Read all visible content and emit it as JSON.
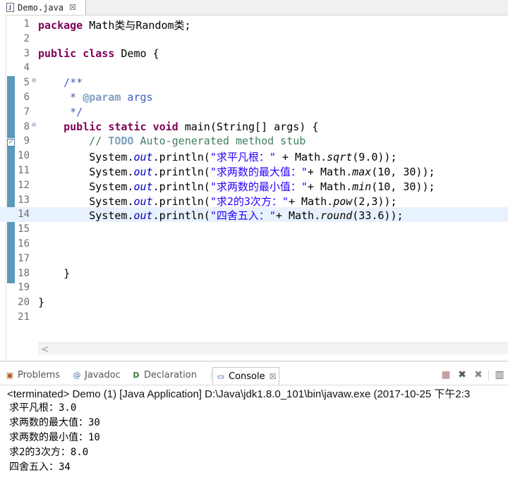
{
  "editor": {
    "tab": {
      "label": "Demo.java",
      "close": "☒"
    },
    "lines": [
      {
        "n": "1",
        "fold": "",
        "html": "<span class=\"kw\">package</span> Math类与Random类;"
      },
      {
        "n": "2",
        "fold": "",
        "html": ""
      },
      {
        "n": "3",
        "fold": "",
        "html": "<span class=\"kw\">public</span> <span class=\"kw\">class</span> Demo {"
      },
      {
        "n": "4",
        "fold": "",
        "html": ""
      },
      {
        "n": "5",
        "fold": "⊖",
        "html": "    <span class=\"jd\">/**</span>"
      },
      {
        "n": "6",
        "fold": "",
        "html": "     <span class=\"jd\">* </span><span class=\"tag\">@param</span><span class=\"jd\"> args</span>"
      },
      {
        "n": "7",
        "fold": "",
        "html": "     <span class=\"jd\">*/</span>"
      },
      {
        "n": "8",
        "fold": "⊖",
        "html": "    <span class=\"kw\">public</span> <span class=\"kw\">static</span> <span class=\"kw\">void</span> main(String[] args) {"
      },
      {
        "n": "9",
        "fold": "",
        "html": "        <span class=\"cm\">// </span><span class=\"todo\">TODO</span><span class=\"cm\"> Auto-generated method stub</span>"
      },
      {
        "n": "10",
        "fold": "",
        "html": "        System.<span class=\"fld\">out</span>.println(<span class=\"str\">\"求平凡根：\"</span> + Math.<span class=\"it\">sqrt</span>(9.0));"
      },
      {
        "n": "11",
        "fold": "",
        "html": "        System.<span class=\"fld\">out</span>.println(<span class=\"str\">\"求两数的最大值：\"</span>+ Math.<span class=\"it\">max</span>(10, 30));"
      },
      {
        "n": "12",
        "fold": "",
        "html": "        System.<span class=\"fld\">out</span>.println(<span class=\"str\">\"求两数的最小值：\"</span>+ Math.<span class=\"it\">min</span>(10, 30));"
      },
      {
        "n": "13",
        "fold": "",
        "html": "        System.<span class=\"fld\">out</span>.println(<span class=\"str\">\"求2的3次方：\"</span>+ Math.<span class=\"it\">pow</span>(2,3));"
      },
      {
        "n": "14",
        "fold": "",
        "html": "        System.<span class=\"fld\">out</span>.println(<span class=\"str\">\"四舍五入：\"</span>+ Math.<span class=\"it\">round</span>(33.6));",
        "current": true
      },
      {
        "n": "15",
        "fold": "",
        "html": ""
      },
      {
        "n": "16",
        "fold": "",
        "html": ""
      },
      {
        "n": "17",
        "fold": "",
        "html": ""
      },
      {
        "n": "18",
        "fold": "",
        "html": "    }"
      },
      {
        "n": "19",
        "fold": "",
        "html": ""
      },
      {
        "n": "20",
        "fold": "",
        "html": "}"
      },
      {
        "n": "21",
        "fold": "",
        "html": ""
      }
    ],
    "scroll_left": "<"
  },
  "panel": {
    "tabs": [
      {
        "icon": "problems-icon",
        "glyph": "▣",
        "label": "Problems"
      },
      {
        "icon": "javadoc-icon",
        "glyph": "@",
        "label": "Javadoc"
      },
      {
        "icon": "declaration-icon",
        "glyph": "D",
        "label": "Declaration"
      },
      {
        "icon": "console-icon",
        "glyph": "▭",
        "label": "Console",
        "close": "☒"
      }
    ],
    "tools": [
      {
        "name": "terminate-icon",
        "glyph": "■"
      },
      {
        "name": "remove-launch-icon",
        "glyph": "✖"
      },
      {
        "name": "remove-all-icon",
        "glyph": "✖"
      },
      {
        "name": "pin-console-icon",
        "glyph": "▥"
      }
    ],
    "console_header": "<terminated> Demo (1) [Java Application] D:\\Java\\jdk1.8.0_101\\bin\\javaw.exe (2017-10-25 下午2:3",
    "output": [
      "求平凡根：3.0",
      "求两数的最大值：30",
      "求两数的最小值：10",
      "求2的3次方：8.0",
      "四舍五入：34"
    ]
  },
  "colors": {
    "keyword": "#7f0055",
    "string": "#2a00ff",
    "comment": "#3f7f5f",
    "javadoc": "#3f5fbf",
    "current_line": "#e8f2fe",
    "ruler_mark": "#5b9ab8"
  }
}
